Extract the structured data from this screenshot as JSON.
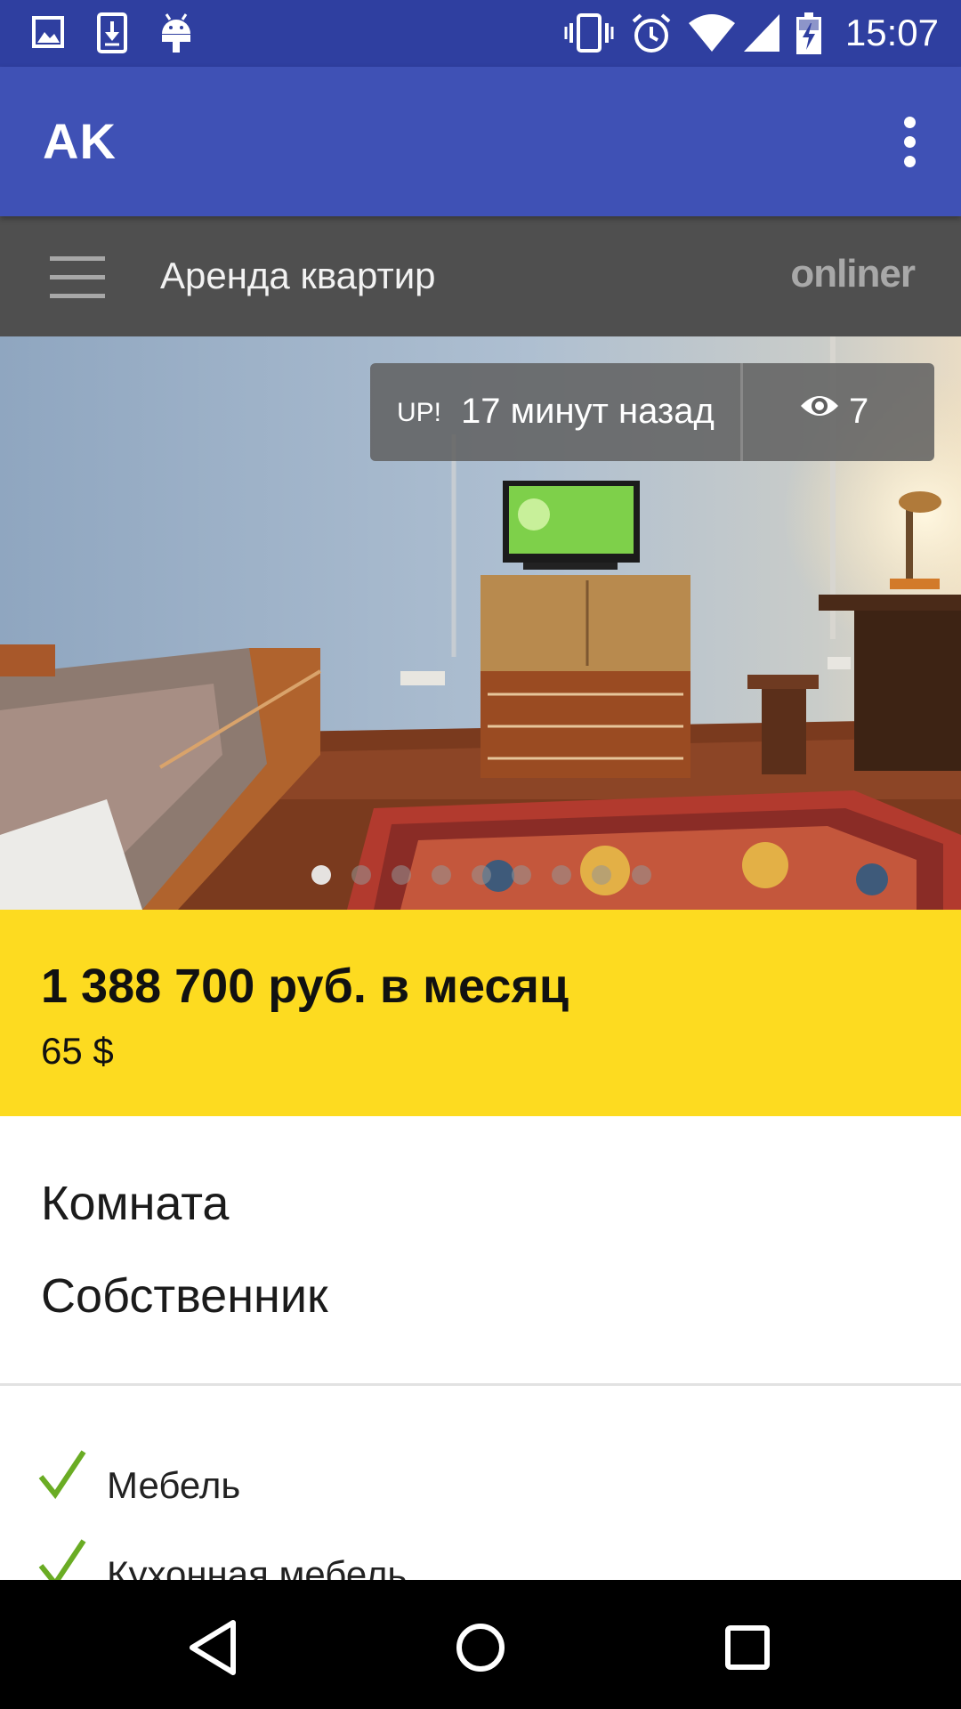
{
  "status_bar": {
    "time": "15:07",
    "left_icons": [
      "image-icon",
      "download-icon",
      "android-icon"
    ],
    "right_icons": [
      "vibrate-icon",
      "alarm-icon",
      "wifi-icon",
      "signal-icon",
      "battery-charging-icon"
    ]
  },
  "app_bar": {
    "title": "AK",
    "overflow_icon": "more-vert-icon",
    "color": "#3f51b5"
  },
  "web_toolbar": {
    "menu_icon": "hamburger-icon",
    "title": "Аренда квартир",
    "brand": "onliner"
  },
  "photo": {
    "badge_label": "UP!",
    "time_ago": "17 минут назад",
    "view_icon": "eye-icon",
    "view_count": "7",
    "page_total": 9,
    "page_current": 1
  },
  "price": {
    "main": "1 388 700 руб. в месяц",
    "usd": "65 $",
    "background": "#fddb20"
  },
  "details": {
    "type": "Комната",
    "owner": "Собственник"
  },
  "features": [
    {
      "label": "Мебель",
      "icon": "check-icon",
      "checked": true
    },
    {
      "label": "Кухонная мебель",
      "icon": "check-icon",
      "checked": true
    }
  ],
  "nav_bar": {
    "buttons": [
      "back-icon",
      "home-icon",
      "recents-icon"
    ]
  }
}
